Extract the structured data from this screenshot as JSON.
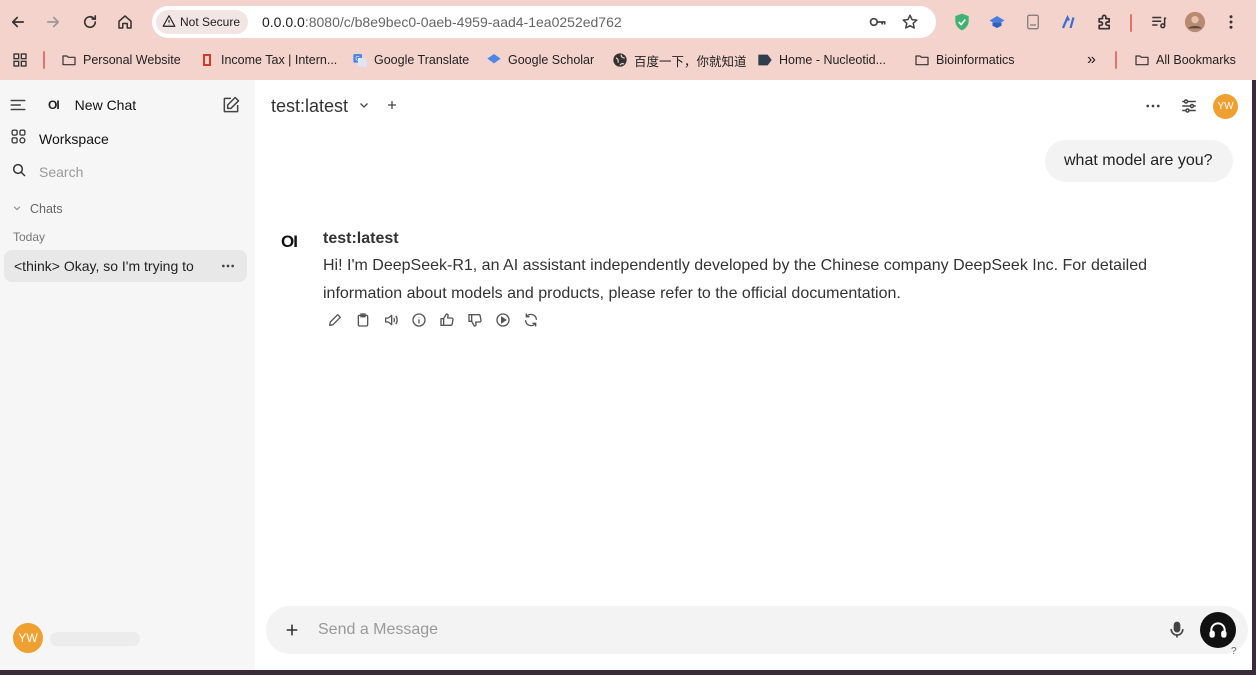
{
  "browser": {
    "security_label": "Not Secure",
    "url_host": "0.0.0.0",
    "url_rest": ":8080/c/b8e9bec0-0aeb-4959-aad4-1ea0252ed762",
    "bookmarks": [
      {
        "label": "Personal Website",
        "icon": "folder-icon"
      },
      {
        "label": "Income Tax | Intern...",
        "icon": "tax-icon"
      },
      {
        "label": "Google Translate",
        "icon": "translate-icon"
      },
      {
        "label": "Google Scholar",
        "icon": "scholar-icon"
      },
      {
        "label": "百度一下，你就知道",
        "icon": "globe-icon"
      },
      {
        "label": "Home - Nucleotid...",
        "icon": "ncbi-icon"
      },
      {
        "label": "Bioinformatics",
        "icon": "folder-icon"
      }
    ],
    "overflow_label": "»",
    "all_bookmarks_label": "All Bookmarks"
  },
  "sidebar": {
    "logo_text": "OI",
    "new_chat_label": "New Chat",
    "workspace_label": "Workspace",
    "search_placeholder": "Search",
    "chats_label": "Chats",
    "today_label": "Today",
    "chat_items": [
      {
        "title": "<think> Okay, so I'm trying to"
      }
    ],
    "user_initials": "YW"
  },
  "header": {
    "model_name": "test:latest",
    "user_initials": "YW"
  },
  "conversation": {
    "user_message": "what model are you?",
    "assistant_logo": "OI",
    "assistant_name": "test:latest",
    "assistant_message": "Hi! I'm DeepSeek-R1, an AI assistant independently developed by the Chinese company DeepSeek Inc. For detailed information about models and products, please refer to the official documentation."
  },
  "composer": {
    "placeholder": "Send a Message",
    "help_label": "?"
  },
  "colors": {
    "chrome_bg": "#f4d3cc",
    "avatar": "#f0a030",
    "sidebar_bg": "#f6f6f6",
    "composer_bg": "#f3f3f3"
  }
}
